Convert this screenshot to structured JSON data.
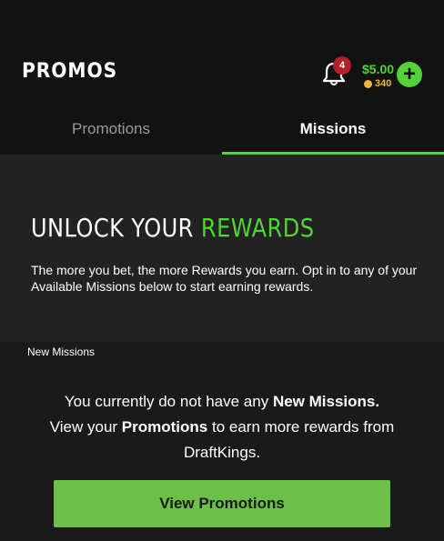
{
  "header": {
    "title": "PROMOS",
    "notification_count": "4",
    "balance": "$5.00",
    "crowns": "340",
    "add_label": "+"
  },
  "tabs": [
    {
      "label": "Promotions",
      "active": false
    },
    {
      "label": "Missions",
      "active": true
    }
  ],
  "hero": {
    "title_prefix": "UNLOCK YOUR ",
    "title_accent": "REWARDS",
    "description": "The more you bet, the more Rewards you earn. Opt in to any of your Available Missions below to start earning rewards."
  },
  "missions": {
    "section_label": "New Missions",
    "empty_part1": "You currently do not have any ",
    "empty_bold1": "New Missions.",
    "empty_part2": "View your ",
    "empty_bold2": "Promotions",
    "empty_part3": " to earn more rewards from DraftKings."
  },
  "cta": {
    "label": "View Promotions"
  },
  "colors": {
    "accent": "#53d337",
    "cta": "#6cc04a",
    "badge": "#b3202a",
    "crowns": "#e8b93c",
    "background": "#1a1a1a"
  }
}
